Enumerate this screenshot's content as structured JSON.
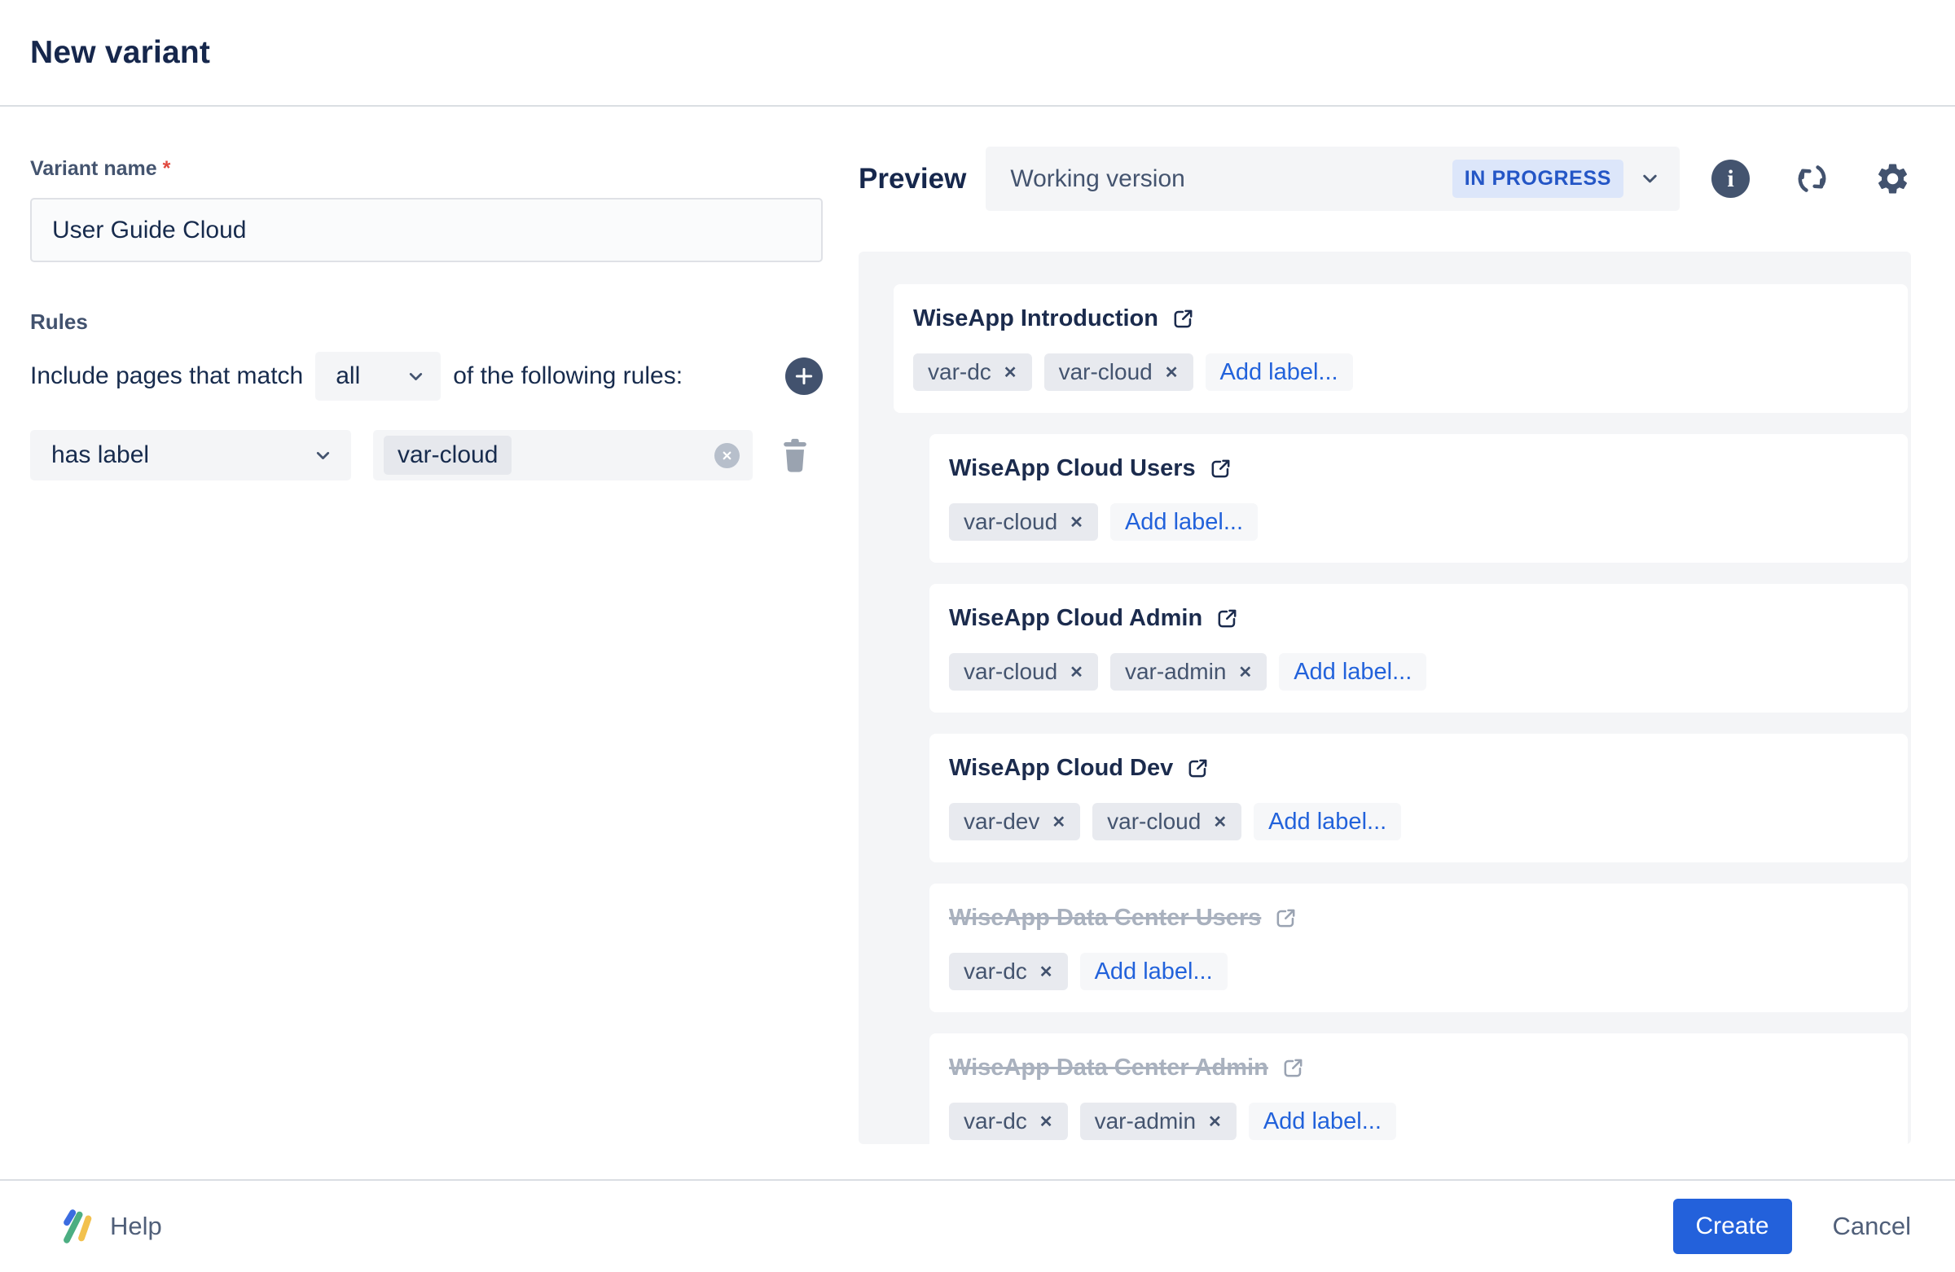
{
  "header": {
    "title": "New variant"
  },
  "form": {
    "variant_name_label": "Variant name",
    "required_mark": "*",
    "variant_name_value": "User Guide Cloud",
    "rules_heading": "Rules",
    "match_text_before": "Include pages that match",
    "match_select_value": "all",
    "match_text_after": "of the following rules:",
    "rule_field_value": "has label",
    "rule_value_tag": "var-cloud"
  },
  "preview": {
    "heading": "Preview",
    "version_name": "Working version",
    "version_status": "IN PROGRESS",
    "add_label_text": "Add label...",
    "pages": [
      {
        "title": "WiseApp Introduction",
        "labels": [
          "var-dc",
          "var-cloud"
        ],
        "indented": false,
        "excluded": false
      },
      {
        "title": "WiseApp Cloud Users",
        "labels": [
          "var-cloud"
        ],
        "indented": true,
        "excluded": false
      },
      {
        "title": "WiseApp Cloud Admin",
        "labels": [
          "var-cloud",
          "var-admin"
        ],
        "indented": true,
        "excluded": false
      },
      {
        "title": "WiseApp Cloud Dev",
        "labels": [
          "var-dev",
          "var-cloud"
        ],
        "indented": true,
        "excluded": false
      },
      {
        "title": "WiseApp Data Center Users",
        "labels": [
          "var-dc"
        ],
        "indented": true,
        "excluded": true
      },
      {
        "title": "WiseApp Data Center Admin",
        "labels": [
          "var-dc",
          "var-admin"
        ],
        "indented": true,
        "excluded": true
      }
    ]
  },
  "footer": {
    "help_label": "Help",
    "create_label": "Create",
    "cancel_label": "Cancel"
  },
  "icons": {
    "info_glyph": "i",
    "remove_glyph": "✕"
  },
  "colors": {
    "accent_blue": "#2361DB",
    "link_blue": "#2262DB",
    "badge_bg": "#DCE6FA",
    "badge_text": "#2456C6",
    "dark_text": "#172B4D",
    "slate": "#44546F",
    "field_bg": "#F4F5F7",
    "pill_bg": "#E8EAEF",
    "excluded_text": "#A9B1BE",
    "required_red": "#E0483E"
  }
}
